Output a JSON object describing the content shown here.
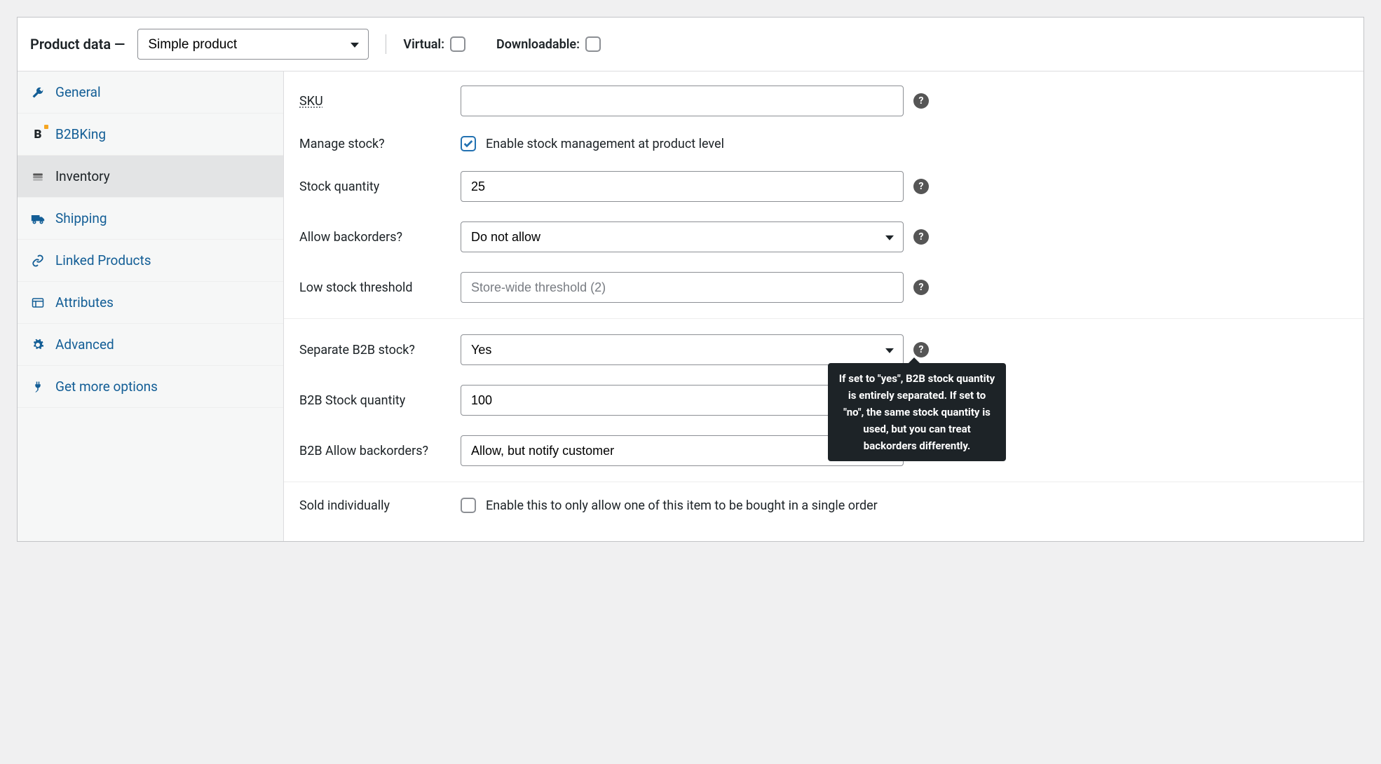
{
  "header": {
    "title": "Product data —",
    "product_type": "Simple product",
    "virtual_label": "Virtual:",
    "virtual_checked": false,
    "downloadable_label": "Downloadable:",
    "downloadable_checked": false
  },
  "tabs": [
    {
      "key": "general",
      "label": "General",
      "icon": "wrench-icon",
      "active": false
    },
    {
      "key": "b2bking",
      "label": "B2BKing",
      "icon": "b2b-icon",
      "active": false
    },
    {
      "key": "inventory",
      "label": "Inventory",
      "icon": "inventory-icon",
      "active": true
    },
    {
      "key": "shipping",
      "label": "Shipping",
      "icon": "truck-icon",
      "active": false
    },
    {
      "key": "linked",
      "label": "Linked Products",
      "icon": "link-icon",
      "active": false
    },
    {
      "key": "attributes",
      "label": "Attributes",
      "icon": "list-icon",
      "active": false
    },
    {
      "key": "advanced",
      "label": "Advanced",
      "icon": "gear-icon",
      "active": false
    },
    {
      "key": "more",
      "label": "Get more options",
      "icon": "plug-icon",
      "active": false
    }
  ],
  "form": {
    "sku": {
      "label": "SKU",
      "value": ""
    },
    "manage_stock": {
      "label": "Manage stock?",
      "desc": "Enable stock management at product level",
      "checked": true
    },
    "stock_quantity": {
      "label": "Stock quantity",
      "value": "25"
    },
    "allow_backorders": {
      "label": "Allow backorders?",
      "value": "Do not allow"
    },
    "low_stock": {
      "label": "Low stock threshold",
      "placeholder": "Store-wide threshold (2)",
      "value": ""
    },
    "separate_b2b": {
      "label": "Separate B2B stock?",
      "value": "Yes",
      "tooltip": "If set to \"yes\", B2B stock quantity is entirely separated. If set to \"no\", the same stock quantity is used, but you can treat backorders differently."
    },
    "b2b_stock": {
      "label": "B2B Stock quantity",
      "value": "100"
    },
    "b2b_backorders": {
      "label": "B2B Allow backorders?",
      "value": "Allow, but notify customer"
    },
    "sold_individually": {
      "label": "Sold individually",
      "desc": "Enable this to only allow one of this item to be bought in a single order",
      "checked": false
    }
  }
}
